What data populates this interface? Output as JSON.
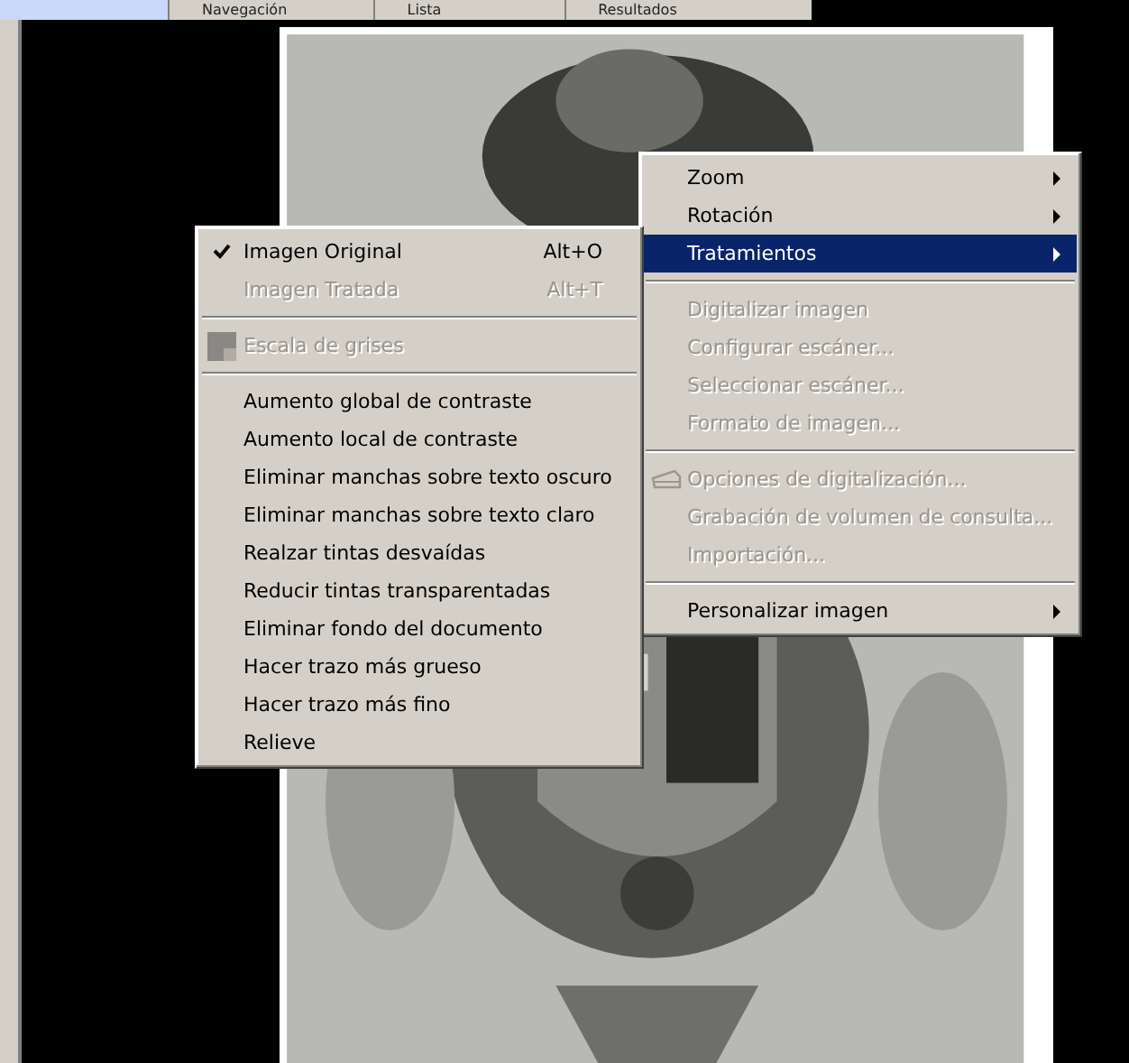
{
  "tabs": [
    {
      "label": "Navegación",
      "selected": false
    },
    {
      "label": "Lista",
      "selected": false
    },
    {
      "label": "Resultados",
      "selected": false
    }
  ],
  "context_menu": {
    "items": [
      {
        "kind": "item",
        "label": "Zoom",
        "submenu": true,
        "selected": false,
        "disabled": false
      },
      {
        "kind": "item",
        "label": "Rotación",
        "submenu": true,
        "selected": false,
        "disabled": false
      },
      {
        "kind": "item",
        "label": "Tratamientos",
        "submenu": true,
        "selected": true,
        "disabled": false
      },
      {
        "kind": "separator"
      },
      {
        "kind": "item",
        "label": "Digitalizar imagen",
        "submenu": false,
        "selected": false,
        "disabled": true
      },
      {
        "kind": "item",
        "label": "Configurar escáner...",
        "submenu": false,
        "selected": false,
        "disabled": true
      },
      {
        "kind": "item",
        "label": "Seleccionar escáner...",
        "submenu": false,
        "selected": false,
        "disabled": true
      },
      {
        "kind": "item",
        "label": "Formato de imagen...",
        "submenu": false,
        "selected": false,
        "disabled": true
      },
      {
        "kind": "separator"
      },
      {
        "kind": "icon",
        "label": "Opciones de digitalización...",
        "submenu": false,
        "selected": false,
        "disabled": true
      },
      {
        "kind": "item",
        "label": "Grabación de volumen de consulta...",
        "submenu": false,
        "selected": false,
        "disabled": true
      },
      {
        "kind": "item",
        "label": "Importación...",
        "submenu": false,
        "selected": false,
        "disabled": true
      },
      {
        "kind": "separator"
      },
      {
        "kind": "item",
        "label": "Personalizar imagen",
        "submenu": true,
        "selected": false,
        "disabled": false
      }
    ]
  },
  "submenu": {
    "items": [
      {
        "kind": "check",
        "label": "Imagen Original",
        "shortcut": "Alt+O",
        "checked": true,
        "disabled": false
      },
      {
        "kind": "check",
        "label": "Imagen Tratada",
        "shortcut": "Alt+T",
        "checked": false,
        "disabled": true
      },
      {
        "kind": "separator"
      },
      {
        "kind": "icon",
        "label": "Escala de grises",
        "disabled": true
      },
      {
        "kind": "separator"
      },
      {
        "kind": "item",
        "label": "Aumento global de contraste",
        "disabled": false
      },
      {
        "kind": "item",
        "label": "Aumento local de contraste",
        "disabled": false
      },
      {
        "kind": "item",
        "label": "Eliminar manchas sobre texto oscuro",
        "disabled": false
      },
      {
        "kind": "item",
        "label": "Eliminar manchas sobre texto claro",
        "disabled": false
      },
      {
        "kind": "item",
        "label": "Realzar tintas desvaídas",
        "disabled": false
      },
      {
        "kind": "item",
        "label": "Reducir tintas transparentadas",
        "disabled": false
      },
      {
        "kind": "item",
        "label": "Eliminar fondo del documento",
        "disabled": false
      },
      {
        "kind": "item",
        "label": "Hacer trazo más grueso",
        "disabled": false
      },
      {
        "kind": "item",
        "label": "Hacer trazo más fino",
        "disabled": false
      },
      {
        "kind": "item",
        "label": "Relieve",
        "disabled": false
      }
    ]
  }
}
